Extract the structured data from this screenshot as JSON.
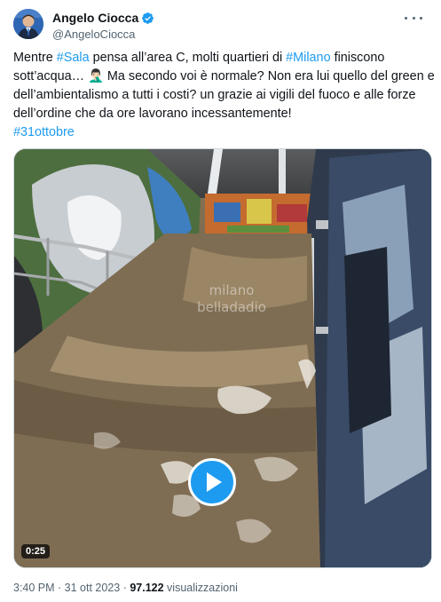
{
  "author": {
    "display_name": "Angelo Ciocca",
    "handle": "@AngeloCiocca",
    "verified": true
  },
  "tweet": {
    "line1": {
      "t1": "Mentre ",
      "l1": "#Sala",
      "t2": " pensa all’area C, molti quartieri di ",
      "l2": "#Milano",
      "t3": " finiscono"
    },
    "line2": "sott’acqua… 🤦🏻‍♂️ Ma secondo voi è normale? Non era lui quello del green e",
    "line3": "dell’ambientalismo a tutti i costi? un grazie ai vigili del fuoco e alle forze",
    "line4": "dell’ordine che da ore lavorano incessantemente!",
    "hashtag": "#31ottobre"
  },
  "media": {
    "watermark_line1": "milano",
    "watermark_line2": "belladadio",
    "duration": "0:25"
  },
  "meta": {
    "time": "3:40 PM",
    "separator1": " · ",
    "date": "31 ott 2023",
    "separator2": " · ",
    "views_count": "97.122",
    "views_label": " visualizzazioni"
  },
  "colors": {
    "link": "#1d9bf0",
    "text": "#0f1419",
    "secondary": "#536471",
    "verified": "#1d9bf0"
  },
  "icons": [
    "verified-badge-icon",
    "more-icon",
    "play-icon"
  ]
}
